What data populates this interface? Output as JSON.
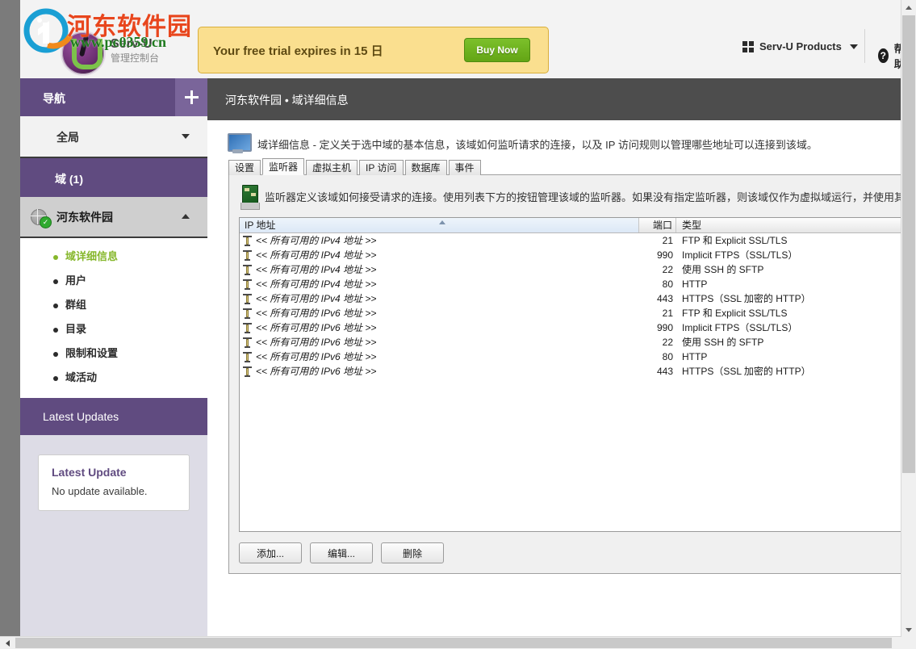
{
  "brand": {
    "name": "Serv-U",
    "subtitle": "管理控制台",
    "watermark_text": "河东软件园",
    "watermark_url": "www.pc0359.cn"
  },
  "trial": {
    "message": "Your free trial expires in 15 日",
    "buy_label": "Buy Now"
  },
  "topbar": {
    "products_label": "Serv-U Products",
    "help_label": "帮助",
    "help_icon": "question-circle-icon",
    "products_icon": "grid-icon",
    "caret_icon": "chevron-down-icon"
  },
  "sidebar": {
    "nav_title": "导航",
    "add_icon": "plus-icon",
    "global_label": "全局",
    "domains_label": "域 (1)",
    "current_domain": "河东软件园",
    "menu": [
      {
        "label": "域详细信息",
        "active": true
      },
      {
        "label": "用户",
        "active": false
      },
      {
        "label": "群组",
        "active": false
      },
      {
        "label": "目录",
        "active": false
      },
      {
        "label": "限制和设置",
        "active": false
      },
      {
        "label": "域活动",
        "active": false
      }
    ],
    "updates_header": "Latest Updates",
    "update_card_title": "Latest Update",
    "update_card_body": "No update available."
  },
  "main": {
    "breadcrumb": "河东软件园 • 域详细信息",
    "page_title": "域详细信息",
    "page_description": "域详细信息 - 定义关于选中域的基本信息，该域如何监听请求的连接，以及 IP 访问规则以管理哪些地址可以连接到该域。",
    "tabs": [
      {
        "label": "设置",
        "active": false
      },
      {
        "label": "监听器",
        "active": true
      },
      {
        "label": "虚拟主机",
        "active": false
      },
      {
        "label": "IP 访问",
        "active": false
      },
      {
        "label": "数据库",
        "active": false
      },
      {
        "label": "事件",
        "active": false
      }
    ],
    "listener_note": "监听器定义该域如何接受请求的连接。使用列表下方的按钮管理该域的监听器。如果没有指定监听器，则该域仅作为虚拟域运行，并使用其他域的监",
    "table": {
      "columns": [
        "IP 地址",
        "端口",
        "类型"
      ],
      "sort_column": "IP 地址",
      "sort_direction": "asc",
      "rows": [
        {
          "ip": "<< 所有可用的 IPv4 地址 >>",
          "port": "21",
          "type": "FTP 和 Explicit SSL/TLS"
        },
        {
          "ip": "<< 所有可用的 IPv4 地址 >>",
          "port": "990",
          "type": "Implicit FTPS（SSL/TLS）"
        },
        {
          "ip": "<< 所有可用的 IPv4 地址 >>",
          "port": "22",
          "type": "使用 SSH 的 SFTP"
        },
        {
          "ip": "<< 所有可用的 IPv4 地址 >>",
          "port": "80",
          "type": "HTTP"
        },
        {
          "ip": "<< 所有可用的 IPv4 地址 >>",
          "port": "443",
          "type": "HTTPS（SSL 加密的 HTTP）"
        },
        {
          "ip": "<< 所有可用的 IPv6 地址 >>",
          "port": "21",
          "type": "FTP 和 Explicit SSL/TLS"
        },
        {
          "ip": "<< 所有可用的 IPv6 地址 >>",
          "port": "990",
          "type": "Implicit FTPS（SSL/TLS）"
        },
        {
          "ip": "<< 所有可用的 IPv6 地址 >>",
          "port": "22",
          "type": "使用 SSH 的 SFTP"
        },
        {
          "ip": "<< 所有可用的 IPv6 地址 >>",
          "port": "80",
          "type": "HTTP"
        },
        {
          "ip": "<< 所有可用的 IPv6 地址 >>",
          "port": "443",
          "type": "HTTPS（SSL 加密的 HTTP）"
        }
      ]
    },
    "buttons": [
      {
        "label": "添加...",
        "name": "add-button"
      },
      {
        "label": "编辑...",
        "name": "edit-button"
      },
      {
        "label": "删除",
        "name": "delete-button"
      }
    ]
  },
  "colors": {
    "purple": "#604b80",
    "purple_light": "#7a659a",
    "sidebar_bg": "#dddce6",
    "crumb_bar": "#4d4d4d",
    "trial_bg": "#fadf8f",
    "buy_green": "#63a515",
    "active_menu": "#86b72b",
    "watermark_red": "#e8461d",
    "watermark_green": "#1f7a1f"
  }
}
